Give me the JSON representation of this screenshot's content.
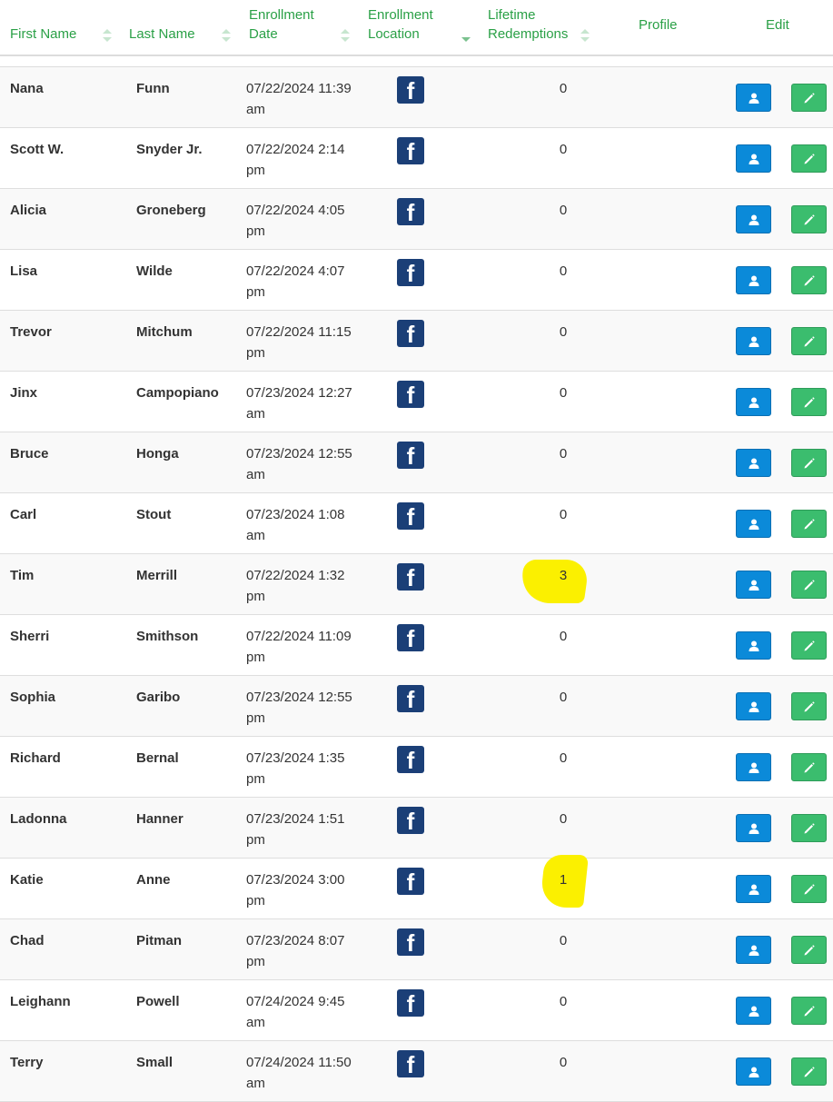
{
  "columns": {
    "first_name": "First Name",
    "last_name": "Last Name",
    "enrollment_date_line1": "Enrollment",
    "enrollment_date_line2": "Date",
    "enrollment_location_line1": "Enrollment",
    "enrollment_location_line2": "Location",
    "lifetime_redemptions_line1": "Lifetime",
    "lifetime_redemptions_line2": "Redemptions",
    "profile": "Profile",
    "edit": "Edit"
  },
  "colors": {
    "header_text": "#2aa046",
    "profile_button": "#0b8ad9",
    "edit_button": "#3bbd6e",
    "facebook": "#1b3f77",
    "highlight": "#fbf000"
  },
  "location_icon": "facebook-icon",
  "rows": [
    {
      "first": "Nana",
      "last": "Funn",
      "date1": "07/22/2024 11:39",
      "date2": "am",
      "redemptions": "0"
    },
    {
      "first": "Scott W.",
      "last": "Snyder Jr.",
      "date1": "07/22/2024 2:14",
      "date2": "pm",
      "redemptions": "0"
    },
    {
      "first": "Alicia",
      "last": "Groneberg",
      "date1": "07/22/2024 4:05",
      "date2": "pm",
      "redemptions": "0"
    },
    {
      "first": "Lisa",
      "last": "Wilde",
      "date1": "07/22/2024 4:07",
      "date2": "pm",
      "redemptions": "0"
    },
    {
      "first": "Trevor",
      "last": "Mitchum",
      "date1": "07/22/2024 11:15",
      "date2": "pm",
      "redemptions": "0"
    },
    {
      "first": "Jinx",
      "last": "Campopiano",
      "date1": "07/23/2024 12:27",
      "date2": "am",
      "redemptions": "0"
    },
    {
      "first": "Bruce",
      "last": "Honga",
      "date1": "07/23/2024 12:55",
      "date2": "am",
      "redemptions": "0"
    },
    {
      "first": "Carl",
      "last": "Stout",
      "date1": "07/23/2024 1:08",
      "date2": "am",
      "redemptions": "0"
    },
    {
      "first": "Tim",
      "last": "Merrill",
      "date1": "07/22/2024 1:32",
      "date2": "pm",
      "redemptions": "3",
      "highlighted": true
    },
    {
      "first": "Sherri",
      "last": "Smithson",
      "date1": "07/22/2024 11:09",
      "date2": "pm",
      "redemptions": "0"
    },
    {
      "first": "Sophia",
      "last": "Garibo",
      "date1": "07/23/2024 12:55",
      "date2": "pm",
      "redemptions": "0"
    },
    {
      "first": "Richard",
      "last": "Bernal",
      "date1": "07/23/2024 1:35",
      "date2": "pm",
      "redemptions": "0"
    },
    {
      "first": "Ladonna",
      "last": "Hanner",
      "date1": "07/23/2024 1:51",
      "date2": "pm",
      "redemptions": "0"
    },
    {
      "first": "Katie",
      "last": "Anne",
      "date1": "07/23/2024 3:00",
      "date2": "pm",
      "redemptions": "1",
      "highlighted": true
    },
    {
      "first": "Chad",
      "last": "Pitman",
      "date1": "07/23/2024 8:07",
      "date2": "pm",
      "redemptions": "0"
    },
    {
      "first": "Leighann",
      "last": "Powell",
      "date1": "07/24/2024 9:45",
      "date2": "am",
      "redemptions": "0"
    },
    {
      "first": "Terry",
      "last": "Small",
      "date1": "07/24/2024 11:50",
      "date2": "am",
      "redemptions": "0"
    }
  ]
}
